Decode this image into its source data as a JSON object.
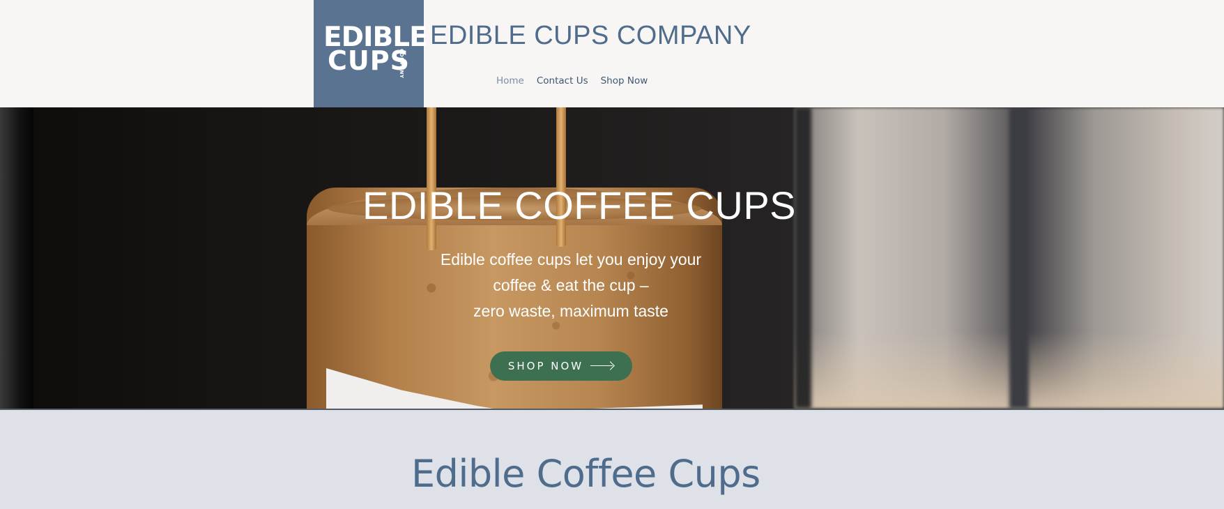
{
  "logo": {
    "line1": "EDIBLE",
    "line2": "CUPS",
    "small": "COMPANY"
  },
  "header": {
    "company_title": "EDIBLE CUPS COMPANY"
  },
  "nav": {
    "items": [
      {
        "label": "Home",
        "active": true
      },
      {
        "label": "Contact Us",
        "active": false
      },
      {
        "label": "Shop Now",
        "active": false
      }
    ]
  },
  "hero": {
    "title": "EDIBLE COFFEE CUPS",
    "subtitle_line1": "Edible coffee cups let you enjoy your",
    "subtitle_line2": "coffee & eat the cup –",
    "subtitle_line3": "zero waste, maximum taste",
    "button_label": "SHOP NOW",
    "button_icon": "arrow-right-icon"
  },
  "section": {
    "title": "Edible Coffee Cups"
  },
  "colors": {
    "brand_blue": "#5a7390",
    "title_blue": "#4f6c8c",
    "button_green": "#3c7050",
    "header_bg": "#f8f6f5",
    "section_bg": "#dee1e8"
  }
}
